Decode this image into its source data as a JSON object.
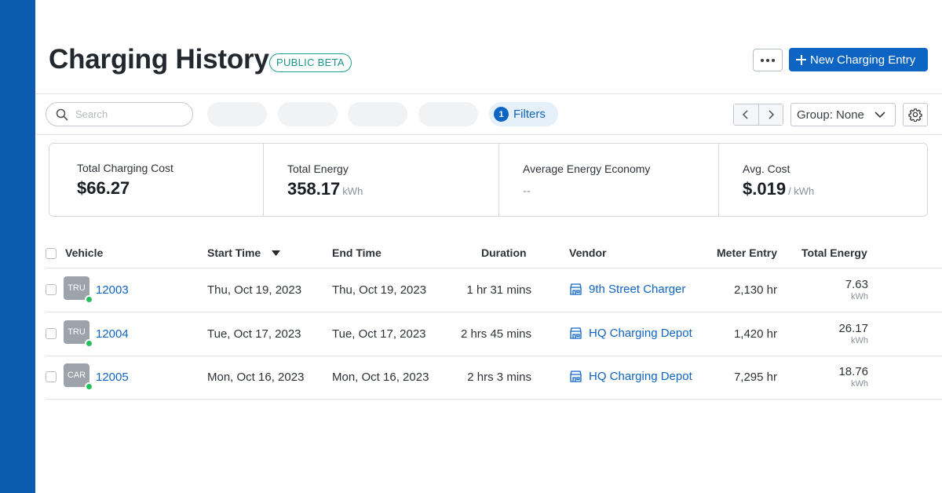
{
  "header": {
    "title": "Charging History",
    "badge": "PUBLIC BETA",
    "new_entry_label": "New Charging Entry"
  },
  "toolbar": {
    "search_placeholder": "Search",
    "filters_count": "1",
    "filters_label": "Filters",
    "group_label": "Group: None"
  },
  "summary": [
    {
      "label": "Total Charging Cost",
      "value": "$66.27",
      "unit": ""
    },
    {
      "label": "Total Energy",
      "value": "358.17",
      "unit": "kWh"
    },
    {
      "label": "Average Energy Economy",
      "value": "--",
      "unit": ""
    },
    {
      "label": "Avg. Cost",
      "value": "$.019",
      "unit": "/ kWh"
    }
  ],
  "table": {
    "columns": [
      "Vehicle",
      "Start Time",
      "End Time",
      "Duration",
      "Vendor",
      "Meter Entry",
      "Total Energy"
    ],
    "rows": [
      {
        "type": "TRU",
        "vehicle": "12003",
        "start": "Thu, Oct 19, 2023",
        "end": "Thu, Oct 19, 2023",
        "duration": "1 hr 31 mins",
        "vendor": "9th Street Charger",
        "meter": "2,130 hr",
        "energy": "7.63",
        "energy_unit": "kWh"
      },
      {
        "type": "TRU",
        "vehicle": "12004",
        "start": "Tue, Oct 17, 2023",
        "end": "Tue, Oct 17, 2023",
        "duration": "2 hrs 45 mins",
        "vendor": "HQ Charging Depot",
        "meter": "1,420 hr",
        "energy": "26.17",
        "energy_unit": "kWh"
      },
      {
        "type": "CAR",
        "vehicle": "12005",
        "start": "Mon, Oct 16, 2023",
        "end": "Mon, Oct 16, 2023",
        "duration": "2 hrs 3 mins",
        "vendor": "HQ Charging Depot",
        "meter": "7,295 hr",
        "energy": "18.76",
        "energy_unit": "kWh"
      }
    ]
  },
  "colors": {
    "rail": "#0b5bb0",
    "accent": "#0e64c3",
    "beta": "#1a9488",
    "online": "#22c35c"
  },
  "icons": [
    "search-icon",
    "chevron-left-icon",
    "chevron-right-icon",
    "chevron-down-icon",
    "gear-icon",
    "store-icon",
    "plus-icon",
    "more-icon",
    "sort-desc-icon"
  ]
}
